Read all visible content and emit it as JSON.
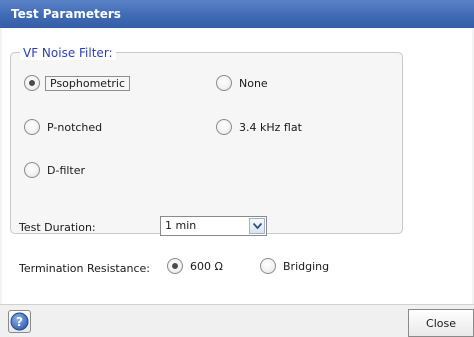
{
  "window": {
    "title": "Test Parameters"
  },
  "vf_filter": {
    "legend": "VF Noise Filter:",
    "options": {
      "psophometric": {
        "label": "Psophometric",
        "selected": true
      },
      "none": {
        "label": "None",
        "selected": false
      },
      "p_notched": {
        "label": "P-notched",
        "selected": false
      },
      "flat_3_4khz": {
        "label": "3.4 kHz flat",
        "selected": false
      },
      "d_filter": {
        "label": "D-filter",
        "selected": false
      }
    }
  },
  "test_duration": {
    "label": "Test Duration:",
    "value": "1 min"
  },
  "termination": {
    "label": "Termination Resistance:",
    "options": {
      "ohm600": {
        "label": "600 Ω",
        "selected": true
      },
      "bridging": {
        "label": "Bridging",
        "selected": false
      }
    }
  },
  "footer": {
    "help_icon": "help-icon",
    "close_label": "Close"
  },
  "colors": {
    "title_bar": "#3f6bb5",
    "legend_text": "#2b3fb5",
    "selected_dot": "#4a4a4a"
  }
}
